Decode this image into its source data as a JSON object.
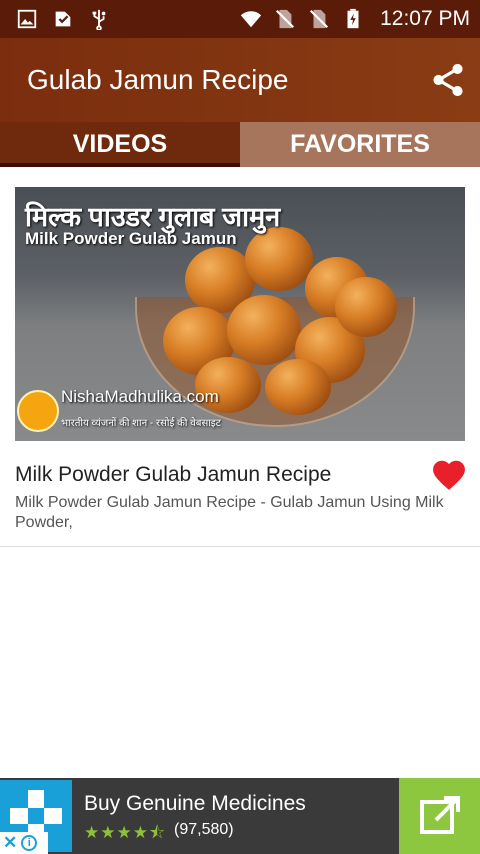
{
  "status_bar": {
    "time": "12:07 PM",
    "left_icons": [
      "image-icon",
      "download-icon",
      "usb-icon"
    ],
    "right_icons": [
      "wifi-icon",
      "no-sim-icon",
      "no-sim-icon",
      "battery-charging-icon"
    ]
  },
  "app_bar": {
    "title": "Gulab Jamun Recipe",
    "share_icon": "share-icon"
  },
  "tabs": [
    {
      "label": "VIDEOS",
      "selected": true
    },
    {
      "label": "FAVORITES",
      "selected": false
    }
  ],
  "video": {
    "thumbnail": {
      "overlay_title_hindi": "मिल्क पाउडर गुलाब जामुन",
      "overlay_title_english": "Milk Powder Gulab Jamun",
      "brand": "NishaMadhulika.com",
      "brand_tagline": "भारतीय व्यंजनों की शान - रसोई की वेबसाइट"
    },
    "title": "Milk Powder Gulab Jamun Recipe",
    "description": "Milk Powder Gulab Jamun Recipe - Gulab Jamun Using Milk Powder,",
    "favorite": true
  },
  "ad": {
    "title": "Buy Genuine Medicines",
    "stars": "★★★★⯪",
    "rating_count": "(97,580)",
    "close_label": "✕",
    "info_label": "i"
  },
  "colors": {
    "status_bar": "#5a1b08",
    "app_bar": "#833611",
    "tab_selected": "#6f2a0d",
    "tab_unselected": "#a7755b",
    "heart": "#e8202a",
    "ad_action": "#8dc63f"
  }
}
